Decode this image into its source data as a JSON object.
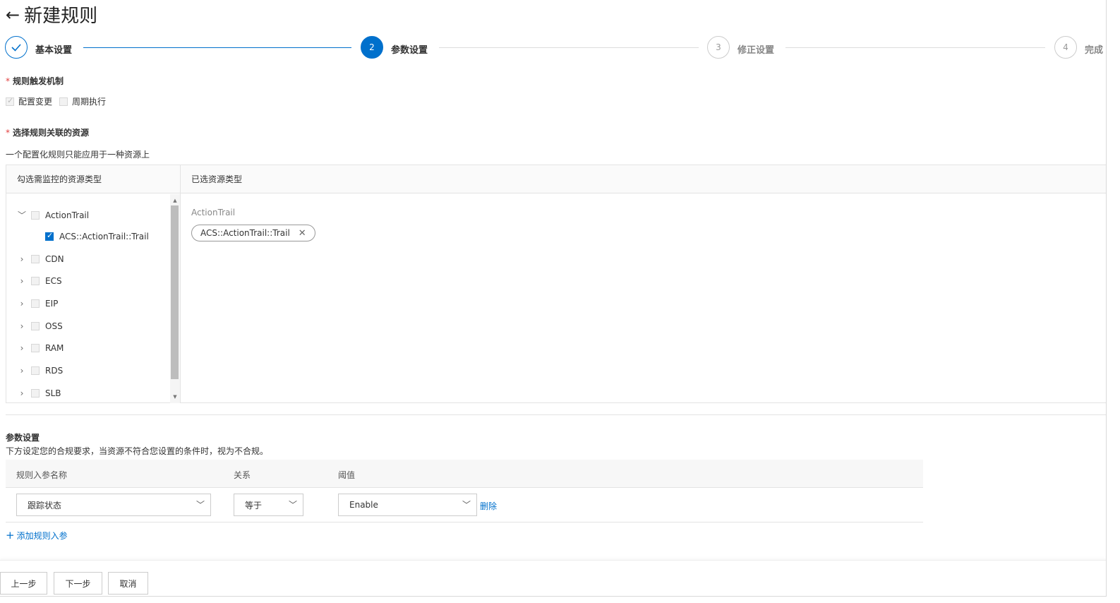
{
  "page": {
    "title": "新建规则",
    "back_icon": "arrow-left-icon"
  },
  "steps": [
    {
      "number": "",
      "label": "基本设置",
      "status": "done",
      "icon": "check-icon"
    },
    {
      "number": "2",
      "label": "参数设置",
      "status": "active"
    },
    {
      "number": "3",
      "label": "修正设置",
      "status": "wait"
    },
    {
      "number": "4",
      "label": "完成",
      "status": "wait"
    }
  ],
  "trigger": {
    "label": "规则触发机制",
    "options": [
      {
        "label": "配置变更",
        "checked": true,
        "disabled": true
      },
      {
        "label": "周期执行",
        "checked": false,
        "disabled": true
      }
    ]
  },
  "resources": {
    "label": "选择规则关联的资源",
    "hint": "一个配置化规则只能应用于一种资源上",
    "left_header": "勾选需监控的资源类型",
    "right_header": "已选资源类型",
    "tree": [
      {
        "label": "ActionTrail",
        "expanded": true,
        "checked": false
      },
      {
        "label": "ACS::ActionTrail::Trail",
        "child": true,
        "checked": true
      },
      {
        "label": "CDN",
        "expanded": false,
        "checked": false
      },
      {
        "label": "ECS",
        "expanded": false,
        "checked": false
      },
      {
        "label": "EIP",
        "expanded": false,
        "checked": false
      },
      {
        "label": "OSS",
        "expanded": false,
        "checked": false
      },
      {
        "label": "RAM",
        "expanded": false,
        "checked": false
      },
      {
        "label": "RDS",
        "expanded": false,
        "checked": false
      },
      {
        "label": "SLB",
        "expanded": false,
        "checked": false
      }
    ],
    "selected_group": "ActionTrail",
    "selected_tags": [
      {
        "label": "ACS::ActionTrail::Trail",
        "remove_icon": "close-icon"
      }
    ]
  },
  "params": {
    "title": "参数设置",
    "desc": "下方设定您的合规要求，当资源不符合您设置的条件时，视为不合规。",
    "headers": {
      "name": "规则入参名称",
      "relation": "关系",
      "threshold": "阈值"
    },
    "rows": [
      {
        "name": "跟踪状态",
        "relation": "等于",
        "threshold": "Enable",
        "delete": "删除"
      }
    ],
    "add_label": "添加规则入参"
  },
  "footer": {
    "prev": "上一步",
    "next": "下一步",
    "cancel": "取消"
  },
  "colors": {
    "accent": "#0070cc",
    "required": "#e24040"
  }
}
